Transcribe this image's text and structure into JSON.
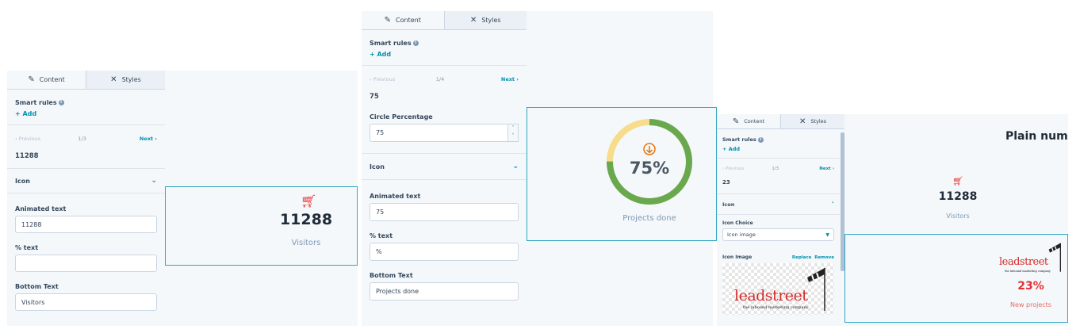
{
  "colors": {
    "accent": "#0091ae",
    "ring_green": "#6aa84f",
    "ring_yellow": "#f7dc8c",
    "arrow_orange": "#e9730c",
    "cart_red": "#e52f2f",
    "pct_red": "#e52f2f"
  },
  "left": {
    "tabs": [
      {
        "label": "Content",
        "icon": "pencil-icon"
      },
      {
        "label": "Styles",
        "icon": "styles-icon"
      }
    ],
    "smart_rules": "Smart rules",
    "add": "+ Add",
    "previous": "‹ Previous",
    "count": "1/3",
    "next": "Next ›",
    "value": "11288",
    "icon_section": "Icon",
    "animated_label": "Animated text",
    "animated_value": "11288",
    "pct_label": "% text",
    "pct_value": "",
    "bottom_label": "Bottom Text",
    "bottom_value": "Visitors"
  },
  "left_preview": {
    "number": "11288",
    "caption": "Visitors"
  },
  "mid": {
    "tabs": [
      {
        "label": "Content",
        "icon": "pencil-icon"
      },
      {
        "label": "Styles",
        "icon": "styles-icon"
      }
    ],
    "smart_rules": "Smart rules",
    "add": "+ Add",
    "previous": "‹ Previous",
    "count": "1/4",
    "next": "Next ›",
    "value": "75",
    "circle_label": "Circle Percentage",
    "circle_value": "75",
    "icon_section": "Icon",
    "animated_label": "Animated text",
    "animated_value": "75",
    "pct_label": "% text",
    "pct_value": "%",
    "bottom_label": "Bottom Text",
    "bottom_value": "Projects done"
  },
  "mid_preview": {
    "percent": 0.75,
    "number": "75%",
    "caption": "Projects done"
  },
  "right": {
    "tabs": [
      {
        "label": "Content",
        "icon": "pencil-icon"
      },
      {
        "label": "Styles",
        "icon": "styles-icon"
      }
    ],
    "smart_rules": "Smart rules",
    "add": "+ Add",
    "previous": "‹ Previous",
    "count": "1/3",
    "next": "Next ›",
    "value": "23",
    "icon_section": "Icon",
    "icon_choice_label": "Icon Choice",
    "icon_choice_value": "Icon image",
    "icon_image_label": "Icon Image",
    "replace": "Replace",
    "remove": "Remove",
    "logo_text": "leadstreet",
    "logo_tagline": "the inbound marketing company"
  },
  "right_preview": {
    "title": "Plain num",
    "number": "11288",
    "caption": "Visitors",
    "logo_text": "leadstreet",
    "logo_tagline": "the inbound marketing company",
    "pct": "23%",
    "pct_caption": "New projects"
  }
}
